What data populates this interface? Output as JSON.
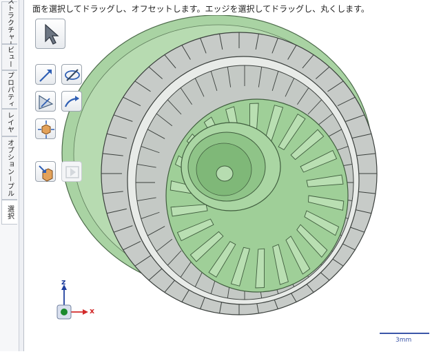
{
  "hint_text": "面を選択してドラッグし、オフセットします。エッジを選択してドラッグし、丸くします。",
  "side_tabs": [
    {
      "label": "ストラクチャー"
    },
    {
      "label": "ビュー"
    },
    {
      "label": "プロパティ"
    },
    {
      "label": "レイヤ"
    },
    {
      "label": "オプション－プル"
    },
    {
      "label": "選択"
    }
  ],
  "tools": [
    {
      "name": "select-tool",
      "icon": "arrow-cursor-icon"
    },
    {
      "name": "pull-direction-tool",
      "icon": "arrow-direction-icon"
    },
    {
      "name": "revolve-tool",
      "icon": "revolve-icon"
    },
    {
      "name": "up-to-tool",
      "icon": "up-to-icon"
    },
    {
      "name": "sweep-tool",
      "icon": "sweep-icon"
    },
    {
      "name": "pivot-tool",
      "icon": "pivot-cube-icon"
    },
    {
      "name": "complete-tool",
      "icon": "complete-icon"
    },
    {
      "name": "next-tool",
      "icon": "next-disabled-icon"
    }
  ],
  "triad": {
    "z_label": "z",
    "x_label": "x"
  },
  "scale_label": "3mm",
  "colors": {
    "model_gray": "#c9cdca",
    "model_green": "#a6d1a0",
    "edge": "#3a3f3c",
    "accent": "#3a55a8"
  }
}
